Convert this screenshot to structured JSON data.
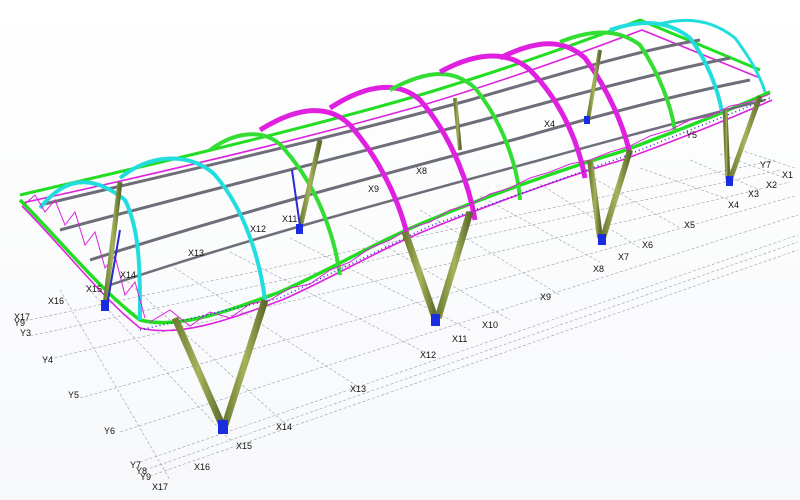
{
  "viewport": {
    "background": "#ffffff"
  },
  "colors": {
    "edge_chord": "#22dd22",
    "web_lattice": "#dd22dd",
    "arch_magenta": "#e020e0",
    "arch_green": "#33dd33",
    "arch_cyan": "#22dddd",
    "purlin": "#6e6e7a",
    "column": "#8a9a45",
    "column_dark": "#5e6b2c",
    "support": "#1a2be0",
    "brace": "#2a2ad0"
  },
  "axes_x_front": [
    "X1",
    "X2",
    "X3",
    "X4",
    "X5",
    "X6",
    "X7",
    "X8",
    "X9",
    "X10",
    "X11",
    "X12",
    "X13",
    "X14",
    "X15",
    "X16",
    "X17"
  ],
  "axes_y_front": [
    "Y4",
    "Y5",
    "Y6",
    "Y7",
    "Y8",
    "Y9"
  ],
  "axes_x_left": [
    "X16",
    "X17"
  ],
  "axes_y_left": [
    "Y3",
    "Y4",
    "Y5",
    "Y6",
    "Y7",
    "Y8",
    "Y9"
  ],
  "canopy_labels": [
    "X4",
    "X5",
    "X6",
    "X7",
    "X8",
    "X9",
    "X10",
    "X11",
    "X12",
    "X13",
    "X14",
    "X15",
    "Y5",
    "Y6",
    "Y7",
    "Y8",
    "Y9"
  ]
}
